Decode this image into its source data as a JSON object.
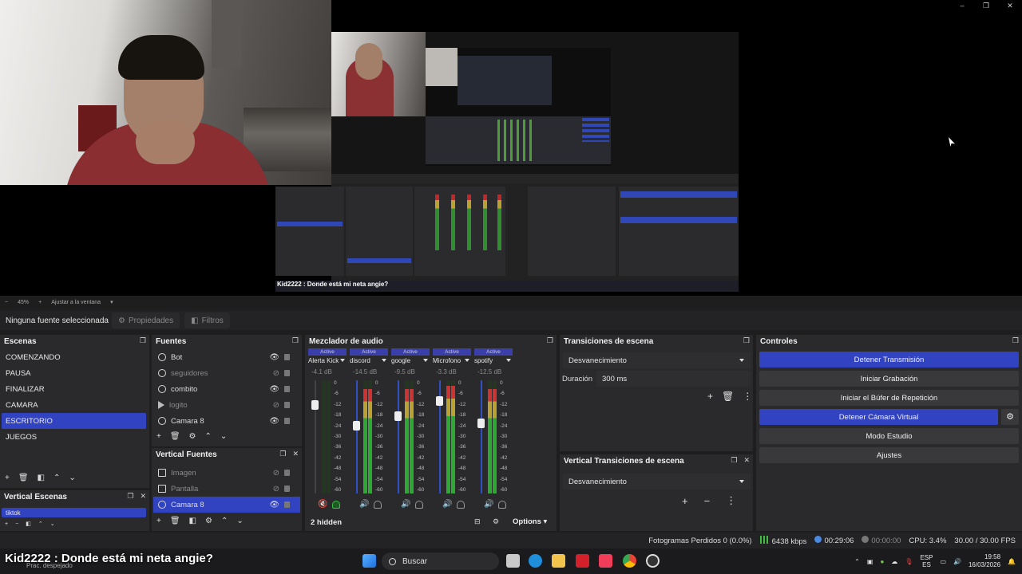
{
  "window": {
    "caps": [
      "–",
      "❐",
      "✕"
    ]
  },
  "preview": {
    "nested_chat": "Kid2222 : Donde está mi neta angie?",
    "zoom": "45%",
    "fit_label": "Ajustar a la ventana"
  },
  "source_toolbar": {
    "no_source": "Ninguna fuente seleccionada",
    "properties": "Propiedades",
    "filters": "Filtros"
  },
  "scenes": {
    "title": "Escenas",
    "items": [
      "COMENZANDO",
      "PAUSA",
      "FINALIZAR",
      "CAMARA",
      "ESCRITORIO",
      "JUEGOS"
    ],
    "selected": "ESCRITORIO"
  },
  "vertical_scenes": {
    "title": "Vertical Escenas",
    "items": [
      "tiktok"
    ]
  },
  "sources": {
    "title": "Fuentes",
    "items": [
      {
        "name": "Bot",
        "icon": "globe-icon"
      },
      {
        "name": "seguidores",
        "icon": "globe-icon"
      },
      {
        "name": "combito",
        "icon": "globe-icon"
      },
      {
        "name": "logito",
        "icon": "play-icon"
      },
      {
        "name": "Camara 8",
        "icon": "camera-icon"
      }
    ]
  },
  "vertical_sources": {
    "title": "Vertical Fuentes",
    "items": [
      {
        "name": "Imagen",
        "icon": "image-icon"
      },
      {
        "name": "Pantalla",
        "icon": "monitor-icon"
      },
      {
        "name": "Camara 8",
        "icon": "camera-icon"
      }
    ]
  },
  "mixer": {
    "title": "Mezclador de audio",
    "hidden": "2 hidden",
    "options": "Options",
    "channels": [
      {
        "status": "Active",
        "name": "Alerta Kick",
        "db": "-4.1 dB",
        "fader": 0.78,
        "meter": 0.0,
        "muted": true,
        "monitor": true
      },
      {
        "status": "Active",
        "name": "discord",
        "db": "-14.5 dB",
        "fader": 0.6,
        "meter": 0.92,
        "muted": false,
        "monitor": false
      },
      {
        "status": "Active",
        "name": "google",
        "db": "-9.5 dB",
        "fader": 0.68,
        "meter": 0.92,
        "muted": false,
        "monitor": false
      },
      {
        "status": "Active",
        "name": "Microfono",
        "db": "-3.3 dB",
        "fader": 0.82,
        "meter": 0.95,
        "muted": false,
        "monitor": false
      },
      {
        "status": "Active",
        "name": "spotify",
        "db": "-12.5 dB",
        "fader": 0.62,
        "meter": 0.92,
        "muted": false,
        "monitor": false
      }
    ],
    "scale": [
      "0",
      "-6",
      "-12",
      "-18",
      "-24",
      "-30",
      "-36",
      "-42",
      "-48",
      "-54",
      "-60"
    ]
  },
  "transitions": {
    "title": "Transiciones de escena",
    "selected": "Desvanecimiento",
    "duration_label": "Duración",
    "duration": "300 ms"
  },
  "vertical_transitions": {
    "title": "Vertical Transiciones de escena",
    "selected": "Desvanecimiento"
  },
  "controls": {
    "title": "Controles",
    "buttons": [
      {
        "label": "Detener Transmisión",
        "active": true
      },
      {
        "label": "Iniciar Grabación",
        "active": false
      },
      {
        "label": "Iniciar el Búfer de Repetición",
        "active": false
      },
      {
        "label": "Detener Cámara Virtual",
        "active": true
      },
      {
        "label": "Modo Estudio",
        "active": false
      },
      {
        "label": "Ajustes",
        "active": false
      }
    ]
  },
  "status": {
    "dropped": "Fotogramas Perdidos 0 (0.0%)",
    "bitrate": "6438 kbps",
    "stream_time": "00:29:06",
    "rec_time": "00:00:00",
    "cpu": "CPU: 3.4%",
    "fps": "30.00 / 30.00 FPS"
  },
  "taskbar": {
    "chat": "Kid2222 : Donde está mi neta angie?",
    "weather": "Prac. despejado",
    "search": "Buscar",
    "lang_top": "ESP",
    "lang_bottom": "ES",
    "time": "19:58",
    "date": "16/03/2026"
  },
  "colors": {
    "accent": "#3243c1",
    "panel": "#2a2a2c",
    "meter_green": "#2fa734"
  }
}
